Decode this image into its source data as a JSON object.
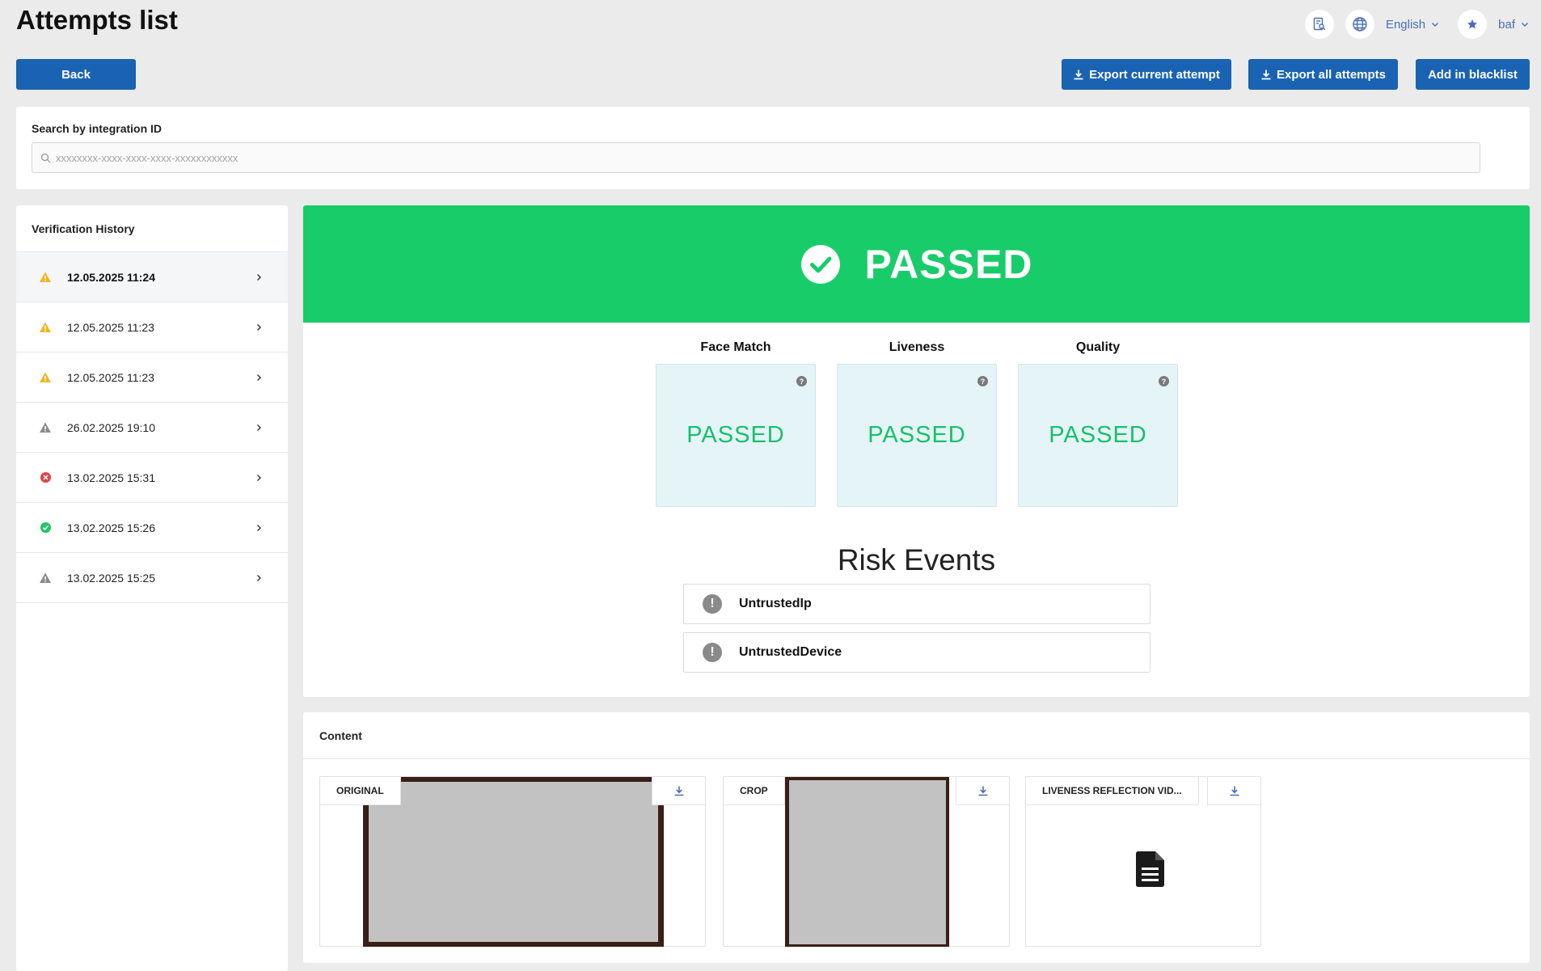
{
  "header": {
    "title": "Attempts list",
    "language": "English",
    "user": "baf",
    "icons": {
      "search_docs": "document-search-icon",
      "globe": "globe-icon",
      "favorite": "star-icon"
    }
  },
  "toolbar": {
    "back_label": "Back",
    "export_current_label": "Export current attempt",
    "export_all_label": "Export all attempts",
    "blacklist_label": "Add in blacklist"
  },
  "search": {
    "label": "Search by integration ID",
    "placeholder": "xxxxxxxx-xxxx-xxxx-xxxx-xxxxxxxxxxxx",
    "value": ""
  },
  "history": {
    "title": "Verification History",
    "items": [
      {
        "date": "12.05.2025 11:24",
        "status": "warning",
        "active": true
      },
      {
        "date": "12.05.2025 11:23",
        "status": "warning",
        "active": false
      },
      {
        "date": "12.05.2025 11:23",
        "status": "warning",
        "active": false
      },
      {
        "date": "26.02.2025 19:10",
        "status": "neutral-warning",
        "active": false
      },
      {
        "date": "13.02.2025 15:31",
        "status": "error",
        "active": false
      },
      {
        "date": "13.02.2025 15:26",
        "status": "success",
        "active": false
      },
      {
        "date": "13.02.2025 15:25",
        "status": "neutral-warning",
        "active": false
      }
    ]
  },
  "result": {
    "status": "PASSED",
    "checks": [
      {
        "title": "Face Match",
        "value": "PASSED"
      },
      {
        "title": "Liveness",
        "value": "PASSED"
      },
      {
        "title": "Quality",
        "value": "PASSED"
      }
    ],
    "risk_title": "Risk Events",
    "risk_events": [
      "UntrustedIp",
      "UntrustedDevice"
    ]
  },
  "content": {
    "title": "Content",
    "tiles": [
      {
        "label": "ORIGINAL",
        "kind": "image"
      },
      {
        "label": "CROP",
        "kind": "image"
      },
      {
        "label": "LIVENESS REFLECTION VID...",
        "kind": "file"
      }
    ]
  },
  "colors": {
    "primary": "#1a63b3",
    "passed_banner": "#18cc6a",
    "passed_text": "#18c06a",
    "warning": "#f2b520",
    "neutral": "#8a8a8a",
    "error": "#e04848",
    "success": "#21c46a",
    "link": "#4a6fb5"
  }
}
